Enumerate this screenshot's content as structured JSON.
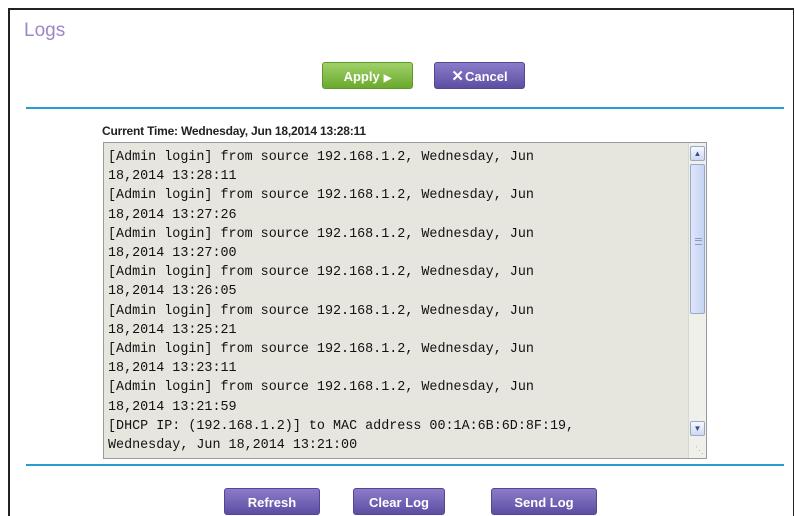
{
  "page": {
    "title": "Logs"
  },
  "toolbar": {
    "apply_label": "Apply",
    "cancel_label": "Cancel"
  },
  "status": {
    "current_time": "Current Time: Wednesday, Jun 18,2014 13:28:11"
  },
  "log": {
    "text": "[Admin login] from source 192.168.1.2, Wednesday, Jun\n18,2014 13:28:11\n[Admin login] from source 192.168.1.2, Wednesday, Jun\n18,2014 13:27:26\n[Admin login] from source 192.168.1.2, Wednesday, Jun\n18,2014 13:27:00\n[Admin login] from source 192.168.1.2, Wednesday, Jun\n18,2014 13:26:05\n[Admin login] from source 192.168.1.2, Wednesday, Jun\n18,2014 13:25:21\n[Admin login] from source 192.168.1.2, Wednesday, Jun\n18,2014 13:23:11\n[Admin login] from source 192.168.1.2, Wednesday, Jun\n18,2014 13:21:59\n[DHCP IP: (192.168.1.2)] to MAC address 00:1A:6B:6D:8F:19,\nWednesday, Jun 18,2014 13:21:00"
  },
  "actions": {
    "refresh_label": "Refresh",
    "clear_log_label": "Clear Log",
    "send_log_label": "Send Log"
  },
  "colors": {
    "title": "#9b89c6",
    "rule": "#2a9cd0",
    "green_button": "#7cbb3c",
    "purple_button": "#6b5cb0"
  },
  "icons": {
    "apply": "play-arrow-icon",
    "cancel": "x-icon",
    "scroll_up": "chevron-up-icon",
    "scroll_down": "chevron-down-icon"
  }
}
